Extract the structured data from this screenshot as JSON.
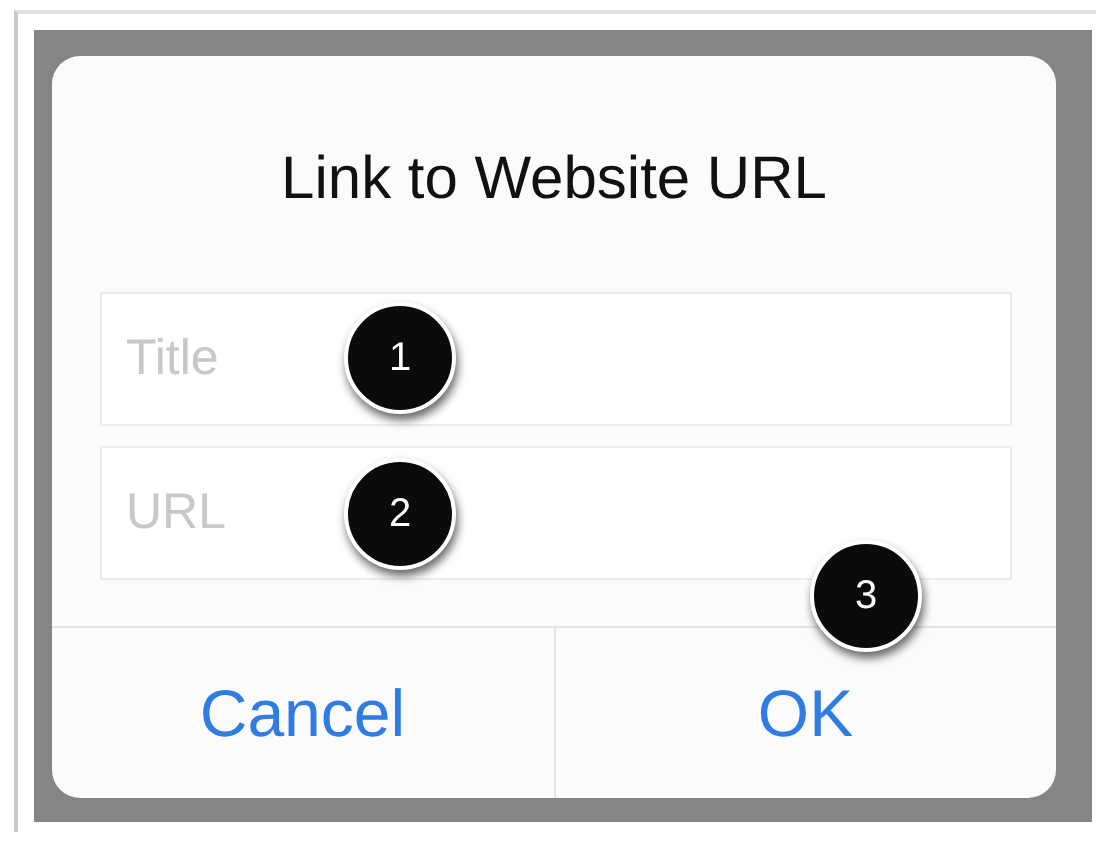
{
  "dialog": {
    "title": "Link to Website URL",
    "fields": [
      {
        "placeholder": "Title"
      },
      {
        "placeholder": "URL"
      }
    ],
    "buttons": [
      {
        "label": "Cancel"
      },
      {
        "label": "OK"
      }
    ]
  },
  "callouts": [
    {
      "number": "1"
    },
    {
      "number": "2"
    },
    {
      "number": "3"
    }
  ]
}
